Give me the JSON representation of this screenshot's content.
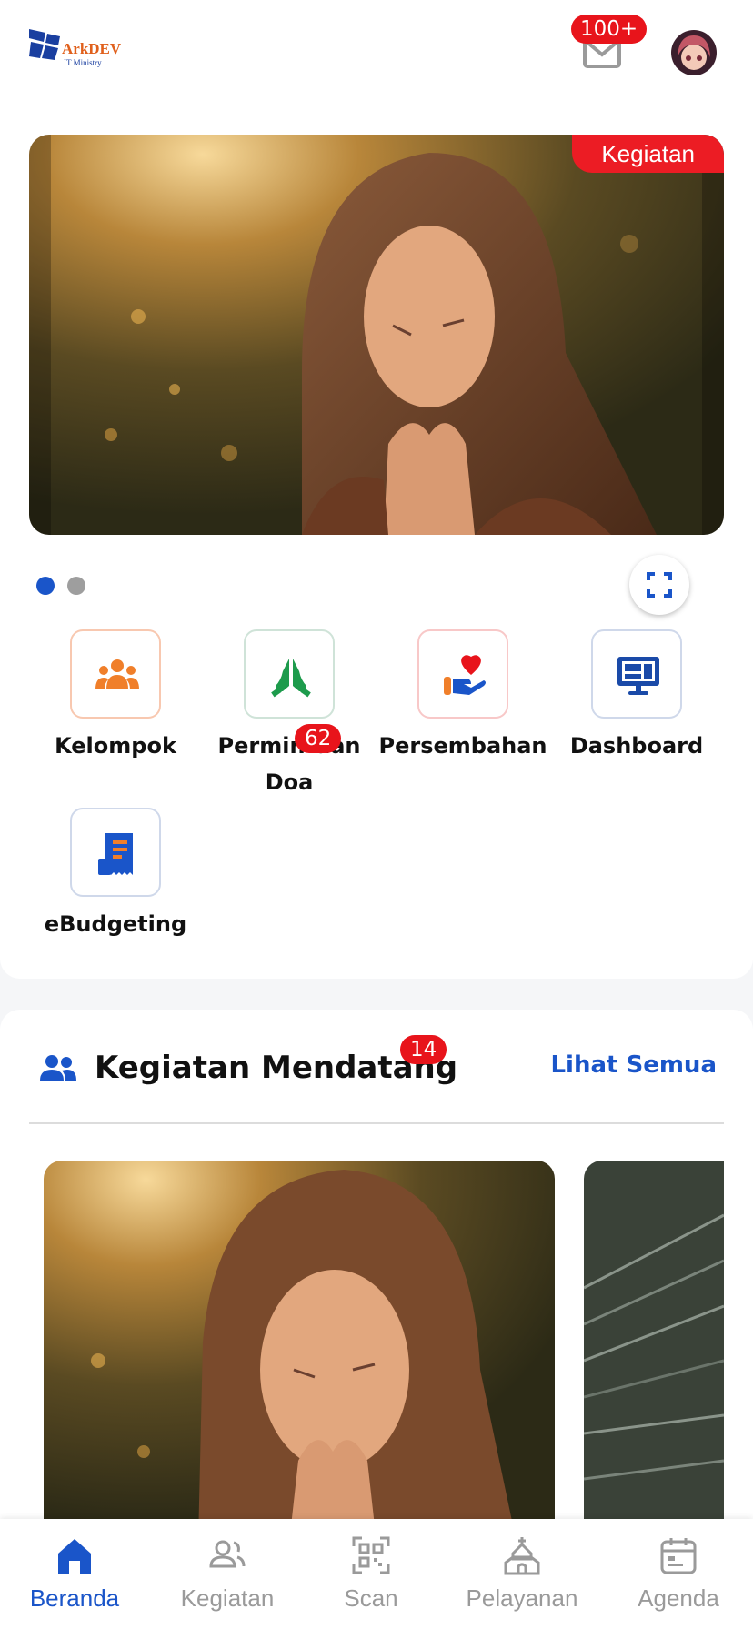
{
  "header": {
    "logo_text": "ArkDEV",
    "logo_subtext": "IT Ministry",
    "mail_badge": "100+"
  },
  "banner": {
    "tag": "Kegiatan",
    "dots_count": 2,
    "active_dot": 0
  },
  "menu": {
    "items": [
      {
        "label": "Kelompok",
        "icon": "people-group-icon",
        "color": "#f07f2a"
      },
      {
        "label": "Permintaan Doa",
        "icon": "praying-hands-icon",
        "color": "#1d9b4c",
        "badge": "62"
      },
      {
        "label": "Persembahan",
        "icon": "hand-heart-icon",
        "color": "#e8141b"
      },
      {
        "label": "Dashboard",
        "icon": "monitor-dashboard-icon",
        "color": "#1a4aa8"
      },
      {
        "label": "eBudgeting",
        "icon": "receipt-icon",
        "color": "#1a55c9"
      }
    ]
  },
  "upcoming": {
    "title": "Kegiatan Mendatang",
    "badge": "14",
    "see_all": "Lihat Semua"
  },
  "bottom_nav": {
    "items": [
      {
        "label": "Beranda",
        "icon": "home-icon",
        "active": true
      },
      {
        "label": "Kegiatan",
        "icon": "users-icon",
        "active": false
      },
      {
        "label": "Scan",
        "icon": "qr-scan-icon",
        "active": false
      },
      {
        "label": "Pelayanan",
        "icon": "church-icon",
        "active": false
      },
      {
        "label": "Agenda",
        "icon": "calendar-icon",
        "active": false
      }
    ]
  },
  "colors": {
    "accent": "#1a55c9",
    "badge": "#e8141b",
    "inactive": "#9a9a9a"
  }
}
